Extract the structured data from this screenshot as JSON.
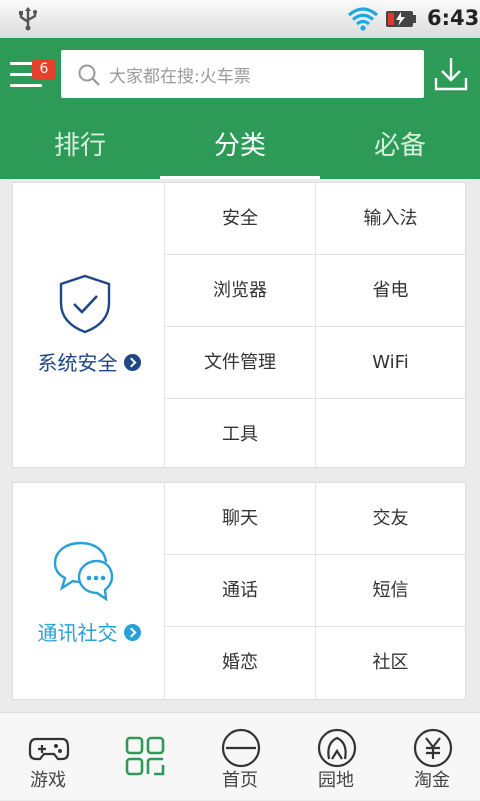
{
  "status_bar": {
    "time": "6:43",
    "icons": [
      "usb-icon",
      "wifi-icon",
      "battery-charging-icon"
    ]
  },
  "header": {
    "badge_count": "6",
    "search_placeholder": "大家都在搜:火车票",
    "tabs": [
      {
        "label": "排行",
        "active": false
      },
      {
        "label": "分类",
        "active": true
      },
      {
        "label": "必备",
        "active": false
      }
    ],
    "accent_color": "#2e9a57"
  },
  "categories": [
    {
      "name": "系统安全",
      "color": "#1e4785",
      "icon": "shield-check-icon",
      "items": [
        "安全",
        "输入法",
        "浏览器",
        "省电",
        "文件管理",
        "WiFi",
        "工具",
        ""
      ]
    },
    {
      "name": "通讯社交",
      "color": "#2aa0d8",
      "icon": "chat-bubbles-icon",
      "items": [
        "聊天",
        "交友",
        "通话",
        "短信",
        "婚恋",
        "社区"
      ]
    }
  ],
  "bottom_nav": [
    {
      "label": "游戏",
      "icon": "gamepad-icon"
    },
    {
      "label": "",
      "icon": "grid-icon",
      "active": true
    },
    {
      "label": "首页",
      "icon": "home-circle-icon"
    },
    {
      "label": "园地",
      "icon": "garden-icon"
    },
    {
      "label": "淘金",
      "icon": "yen-coin-icon"
    }
  ]
}
